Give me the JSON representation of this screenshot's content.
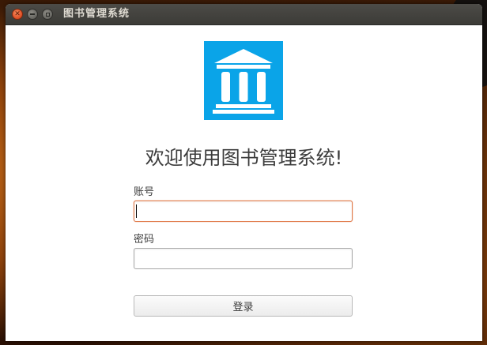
{
  "window": {
    "title": "图书管理系统",
    "controls": {
      "close_icon": "close-icon",
      "minimize_icon": "minimize-icon",
      "maximize_icon": "maximize-icon"
    }
  },
  "logo": {
    "icon": "library-building-icon",
    "background_color": "#0aa4e8",
    "foreground_color": "#ffffff"
  },
  "welcome_text": "欢迎使用图书管理系统!",
  "form": {
    "account": {
      "label": "账号",
      "value": "",
      "placeholder": "",
      "focused": true
    },
    "password": {
      "label": "密码",
      "value": "",
      "placeholder": ""
    },
    "login_label": "登录"
  },
  "colors": {
    "titlebar": "#3c3b37",
    "close_button": "#e3542a",
    "focus_border": "#e07a4a",
    "logo_blue": "#0aa4e8"
  }
}
